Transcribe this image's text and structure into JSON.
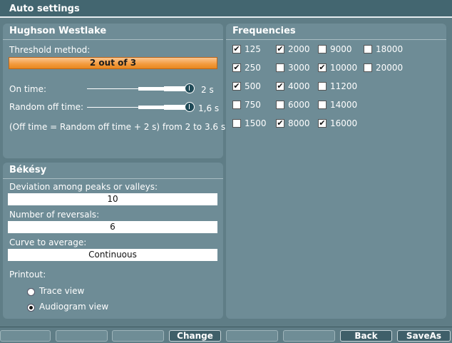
{
  "window": {
    "title": "Auto settings"
  },
  "hughson": {
    "title": "Hughson Westlake",
    "threshold_label": "Threshold method:",
    "threshold_value": "2 out of 3",
    "on_time_label": "On time:",
    "on_time_value": "2 s",
    "random_off_label": "Random off time:",
    "random_off_value": "1,6 s",
    "note": "(Off time = Random off time + 2 s) from 2 to 3.6 s"
  },
  "bekesy": {
    "title": "Békésy",
    "deviation_label": "Deviation among peaks or valleys:",
    "deviation_value": "10",
    "reversals_label": "Number of reversals:",
    "reversals_value": "6",
    "curve_label": "Curve to average:",
    "curve_value": "Continuous",
    "printout_label": "Printout:",
    "options": [
      {
        "label": "Trace view",
        "selected": false
      },
      {
        "label": "Audiogram view",
        "selected": true
      }
    ]
  },
  "frequencies": {
    "title": "Frequencies",
    "items": [
      {
        "label": "125",
        "checked": true
      },
      {
        "label": "2000",
        "checked": true
      },
      {
        "label": "9000",
        "checked": false
      },
      {
        "label": "18000",
        "checked": false
      },
      {
        "label": "250",
        "checked": true
      },
      {
        "label": "3000",
        "checked": false
      },
      {
        "label": "10000",
        "checked": true
      },
      {
        "label": "20000",
        "checked": false
      },
      {
        "label": "500",
        "checked": true
      },
      {
        "label": "4000",
        "checked": true
      },
      {
        "label": "11200",
        "checked": false
      },
      {
        "label": "750",
        "checked": false
      },
      {
        "label": "6000",
        "checked": false
      },
      {
        "label": "14000",
        "checked": false
      },
      {
        "label": "1500",
        "checked": false
      },
      {
        "label": "8000",
        "checked": true
      },
      {
        "label": "16000",
        "checked": true
      }
    ]
  },
  "toolbar": {
    "buttons": [
      "",
      "",
      "",
      "Change",
      "",
      "",
      "Back",
      "SaveAs"
    ]
  },
  "colors": {
    "accent": "#f39a3c",
    "panel": "#6e8c96",
    "background": "#5f7d86"
  }
}
